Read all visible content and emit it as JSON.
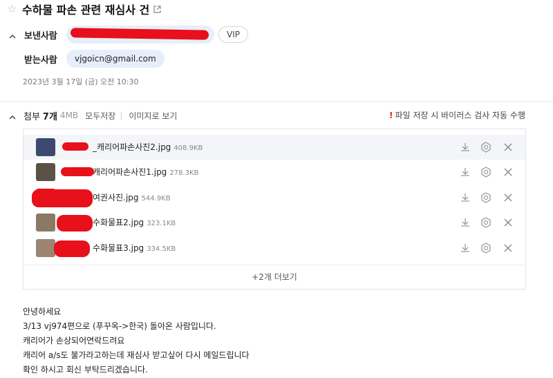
{
  "mail": {
    "title": "수하물 파손 관련 재심사 건",
    "sender_label": "보낸사람",
    "sender_badge": "VIP",
    "receiver_label": "받는사람",
    "receiver_email": "vjgoicn@gmail.com",
    "date": "2023년 3월 17일 (금) 오전 10:30"
  },
  "attachments": {
    "label": "첨부",
    "count": "7개",
    "total_size": "4MB",
    "save_all": "모두저장",
    "view_as_image": "이미지로 보기",
    "virus_note": "파일 저장 시 바이러스 검사 자동 수행",
    "files": [
      {
        "name": "_캐리어파손사진2.jpg",
        "size": "408.9KB",
        "thumb": "#3b4a6e"
      },
      {
        "name": "캐리어파손사진1.jpg",
        "size": "278.3KB",
        "thumb": "#5b5246"
      },
      {
        "name": "여권사진.jpg",
        "size": "544.9KB",
        "thumb": "#e8101a"
      },
      {
        "name": "수화물표2.jpg",
        "size": "323.1KB",
        "thumb": "#8a7a63"
      },
      {
        "name": "수화물표3.jpg",
        "size": "334.5KB",
        "thumb": "#9c8470"
      }
    ],
    "more": "+2개 더보기"
  },
  "body_lines": [
    "안녕하세요",
    "3/13 vj974편으로 (푸꾸옥->한국) 돌아온 사람입니다.",
    "캐리어가 손상되어연락드려요",
    "캐리어 a/s도 불가라고하는데 재심사 받고싶어 다시 메일드립니다",
    "확인 하시고 회신 부탁드리겠습니다."
  ],
  "colors": {
    "accent_chip": "#e6eefb",
    "redaction": "#e8101a",
    "warning": "#e01a1a"
  }
}
